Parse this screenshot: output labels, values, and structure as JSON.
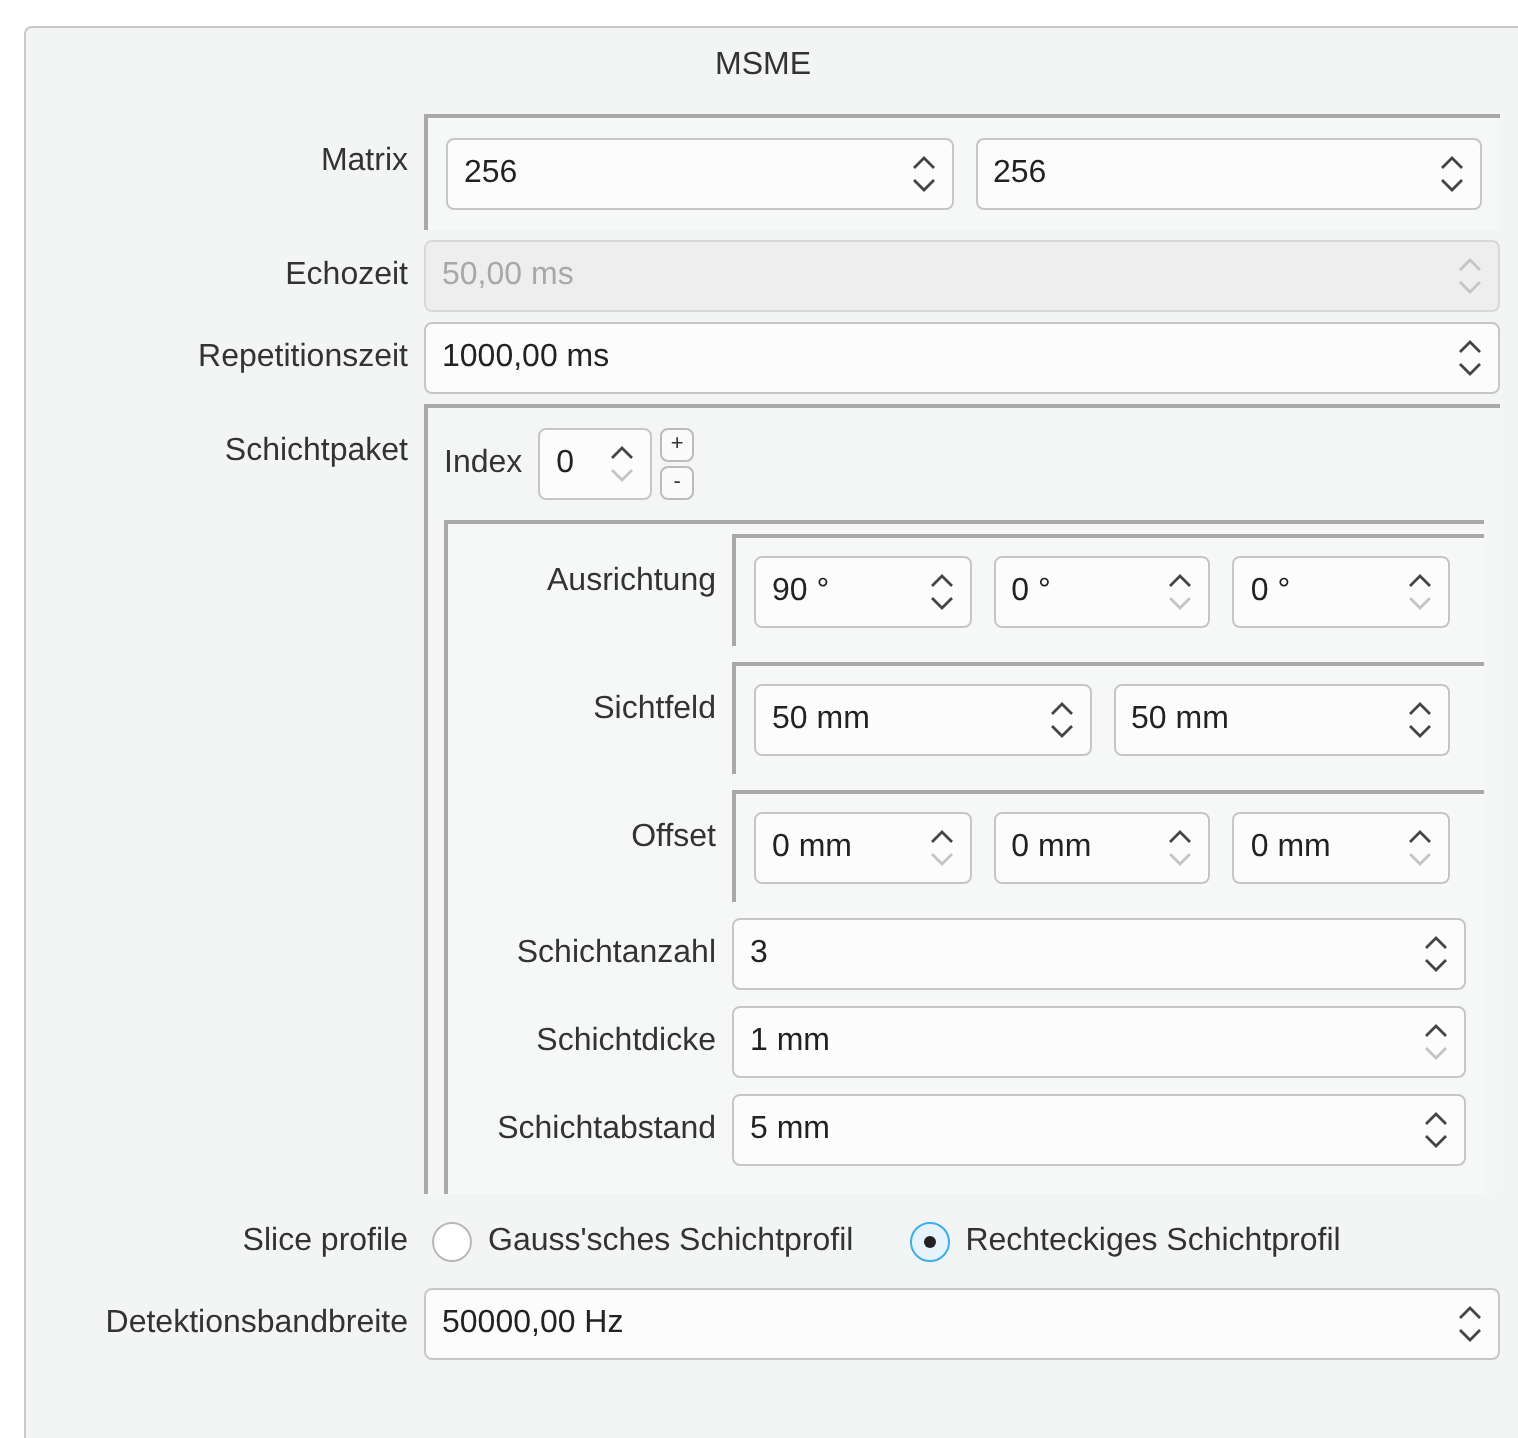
{
  "title": "MSME",
  "rows": [
    {
      "kind": "group",
      "label": "Matrix",
      "fields": [
        {
          "value": "256",
          "disabled": false,
          "at_minimum": false
        },
        {
          "value": "256",
          "disabled": false,
          "at_minimum": false
        }
      ]
    },
    {
      "kind": "spin",
      "label": "Echozeit",
      "field": {
        "value": "50,00 ms",
        "disabled": true,
        "at_minimum": false
      }
    },
    {
      "kind": "spin",
      "label": "Repetitionszeit",
      "field": {
        "value": "1000,00 ms",
        "disabled": false,
        "at_minimum": false
      }
    },
    {
      "kind": "package",
      "label": "Schichtpaket",
      "index_label": "Index",
      "index": {
        "value": "0",
        "disabled": false,
        "at_minimum": true
      },
      "add": "+",
      "remove": "-",
      "rows": [
        {
          "kind": "group",
          "label": "Ausrichtung",
          "fields": [
            {
              "value": "90 °",
              "disabled": false,
              "at_minimum": false
            },
            {
              "value": "0 °",
              "disabled": false,
              "at_minimum": true
            },
            {
              "value": "0 °",
              "disabled": false,
              "at_minimum": true
            }
          ]
        },
        {
          "kind": "group",
          "label": "Sichtfeld",
          "fields": [
            {
              "value": "50 mm",
              "disabled": false,
              "at_minimum": false
            },
            {
              "value": "50 mm",
              "disabled": false,
              "at_minimum": false
            }
          ]
        },
        {
          "kind": "group",
          "label": "Offset",
          "fields": [
            {
              "value": "0 mm",
              "disabled": false,
              "at_minimum": true
            },
            {
              "value": "0 mm",
              "disabled": false,
              "at_minimum": true
            },
            {
              "value": "0 mm",
              "disabled": false,
              "at_minimum": true
            }
          ]
        },
        {
          "kind": "spin",
          "label": "Schichtanzahl",
          "field": {
            "value": "3",
            "disabled": false,
            "at_minimum": false
          }
        },
        {
          "kind": "spin",
          "label": "Schichtdicke",
          "field": {
            "value": "1 mm",
            "disabled": false,
            "at_minimum": true
          }
        },
        {
          "kind": "spin",
          "label": "Schichtabstand",
          "field": {
            "value": "5 mm",
            "disabled": false,
            "at_minimum": false
          }
        }
      ]
    },
    {
      "kind": "radio",
      "label": "Slice profile",
      "options": [
        {
          "label": "Gauss'sches Schichtprofil",
          "selected": false
        },
        {
          "label": "Rechteckiges Schichtprofil",
          "selected": true
        }
      ]
    },
    {
      "kind": "spin",
      "label": "Detektionsbandbreite",
      "field": {
        "value": "50000,00 Hz",
        "disabled": false,
        "at_minimum": false
      }
    }
  ]
}
